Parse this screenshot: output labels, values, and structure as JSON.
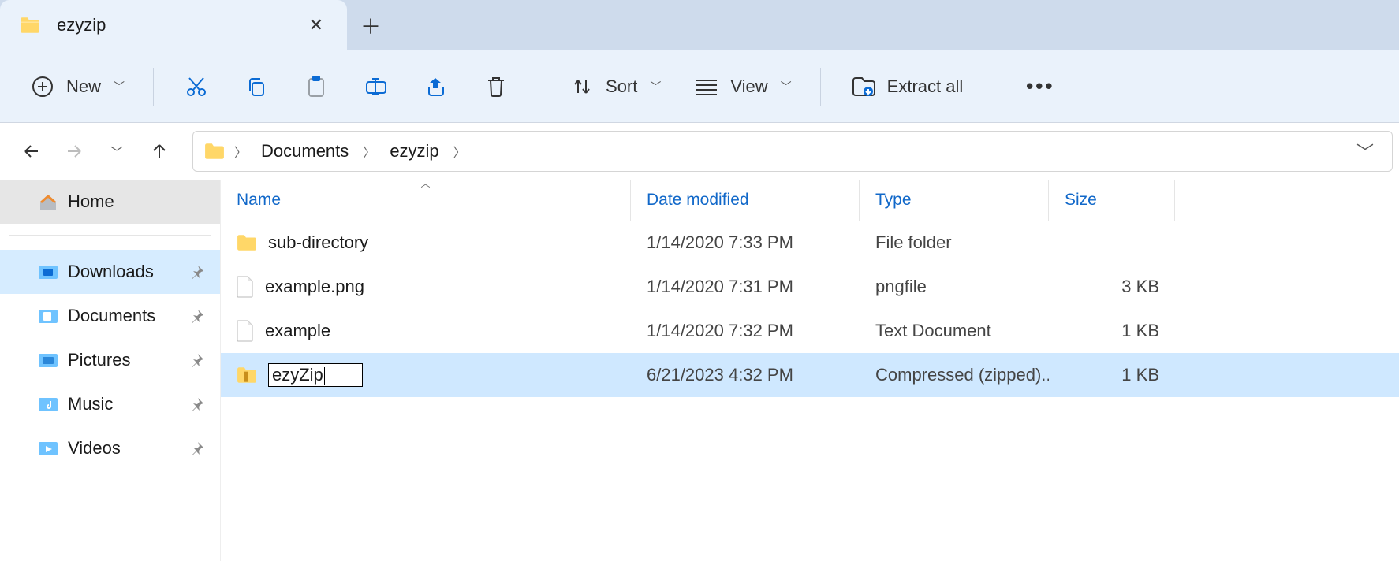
{
  "tab": {
    "title": "ezyzip"
  },
  "toolbar": {
    "new_label": "New",
    "sort_label": "Sort",
    "view_label": "View",
    "extract_label": "Extract all"
  },
  "breadcrumb": {
    "items": [
      "Documents",
      "ezyzip"
    ]
  },
  "sidebar": {
    "home": "Home",
    "items": [
      {
        "label": "Downloads"
      },
      {
        "label": "Documents"
      },
      {
        "label": "Pictures"
      },
      {
        "label": "Music"
      },
      {
        "label": "Videos"
      }
    ]
  },
  "columns": {
    "name": "Name",
    "date": "Date modified",
    "type": "Type",
    "size": "Size"
  },
  "files": [
    {
      "name": "sub-directory",
      "date": "1/14/2020 7:33 PM",
      "type": "File folder",
      "size": ""
    },
    {
      "name": "example.png",
      "date": "1/14/2020 7:31 PM",
      "type": "pngfile",
      "size": "3 KB"
    },
    {
      "name": "example",
      "date": "1/14/2020 7:32 PM",
      "type": "Text Document",
      "size": "1 KB"
    },
    {
      "name": "ezyZip",
      "date": "6/21/2023 4:32 PM",
      "type": "Compressed (zipped)...",
      "size": "1 KB"
    }
  ]
}
